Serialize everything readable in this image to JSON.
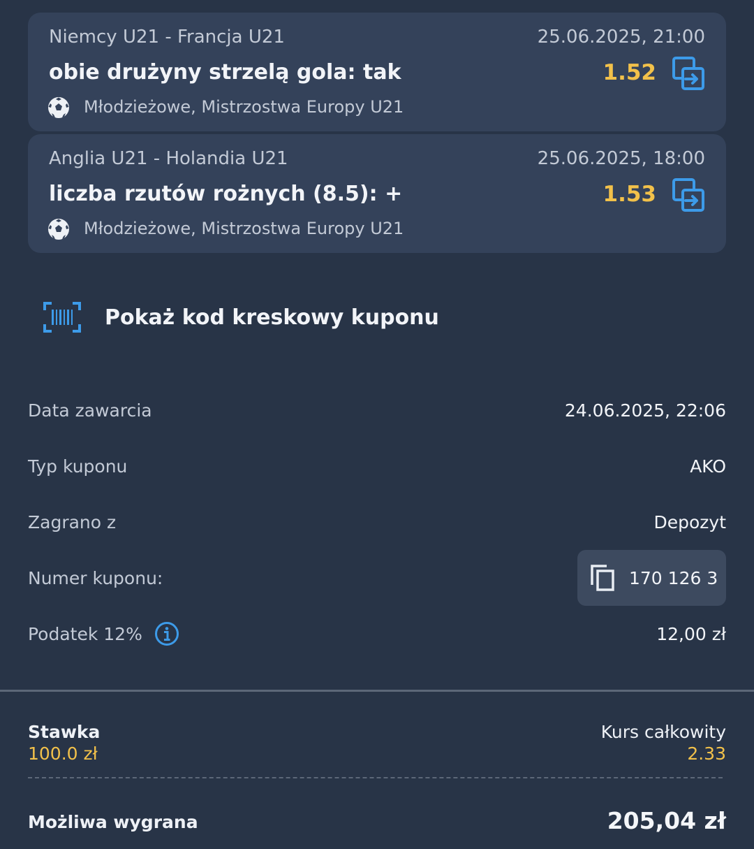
{
  "colors": {
    "background": "#283447",
    "card": "#34425a",
    "odds_yellow": "#f2c14a",
    "accent_blue": "#3d9be9"
  },
  "bets": [
    {
      "teams": "Niemcy U21 - Francja U21",
      "date": "25.06.2025, 21:00",
      "pick": "obie drużyny strzelą gola: tak",
      "odds": "1.52",
      "league": "Młodzieżowe, Mistrzostwa Europy U21",
      "sport_icon": "soccer-ball-icon",
      "action_icon": "swap-icon"
    },
    {
      "teams": "Anglia U21 - Holandia U21",
      "date": "25.06.2025, 18:00",
      "pick": "liczba rzutów rożnych (8.5): +",
      "odds": "1.53",
      "league": "Młodzieżowe, Mistrzostwa Europy U21",
      "sport_icon": "soccer-ball-icon",
      "action_icon": "swap-icon"
    }
  ],
  "barcode": {
    "label": "Pokaż kod kreskowy kuponu",
    "icon": "barcode-icon"
  },
  "details": {
    "date_label": "Data zawarcia",
    "date_value": "24.06.2025, 22:06",
    "type_label": "Typ kuponu",
    "type_value": "AKO",
    "source_label": "Zagrano z",
    "source_value": "Depozyt",
    "number_label": "Numer kuponu:",
    "number_value": "170 126 3",
    "tax_label": "Podatek 12%",
    "tax_value": "12,00 zł"
  },
  "summary": {
    "stake_label": "Stawka",
    "stake_value": "100.0 zł",
    "total_odds_label": "Kurs całkowity",
    "total_odds_value": "2.33",
    "win_label": "Możliwa wygrana",
    "win_value": "205,04 zł"
  }
}
